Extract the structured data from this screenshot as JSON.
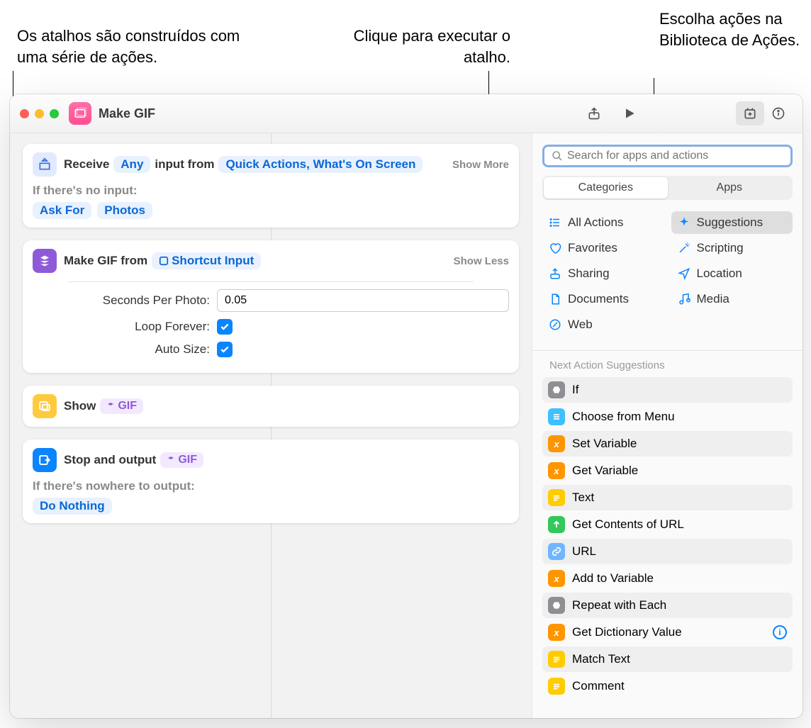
{
  "callouts": {
    "left": "Os atalhos são construídos com uma série de ações.",
    "center": "Clique para executar o atalho.",
    "right": "Escolha ações na Biblioteca de Ações."
  },
  "window": {
    "title": "Make GIF"
  },
  "toolbar": {
    "share_label": "Share",
    "run_label": "Run",
    "library_label": "Action Library",
    "info_label": "Info"
  },
  "editor": {
    "receive": {
      "prefix": "Receive",
      "any": "Any",
      "middle": "input from",
      "from": "Quick Actions, What's On Screen",
      "show_more": "Show More",
      "no_input_label": "If there's no input:",
      "no_input_1": "Ask For",
      "no_input_2": "Photos"
    },
    "makegif": {
      "prefix": "Make GIF from",
      "input_chip": "Shortcut Input",
      "show_less": "Show Less",
      "seconds_label": "Seconds Per Photo:",
      "seconds_value": "0.05",
      "loop_label": "Loop Forever:",
      "auto_label": "Auto Size:"
    },
    "show": {
      "prefix": "Show",
      "chip": "GIF"
    },
    "output": {
      "prefix": "Stop and output",
      "chip": "GIF",
      "nowhere_label": "If there's nowhere to output:",
      "nowhere_chip": "Do Nothing"
    }
  },
  "sidebar": {
    "search_placeholder": "Search for apps and actions",
    "seg": {
      "categories": "Categories",
      "apps": "Apps"
    },
    "cats": [
      {
        "label": "All Actions",
        "icon": "list"
      },
      {
        "label": "Suggestions",
        "icon": "sparkle",
        "selected": true
      },
      {
        "label": "Favorites",
        "icon": "heart"
      },
      {
        "label": "Scripting",
        "icon": "wand"
      },
      {
        "label": "Sharing",
        "icon": "share"
      },
      {
        "label": "Location",
        "icon": "nav"
      },
      {
        "label": "Documents",
        "icon": "doc"
      },
      {
        "label": "Media",
        "icon": "music"
      },
      {
        "label": "Web",
        "icon": "safari"
      }
    ],
    "sugg_title": "Next Action Suggestions",
    "suggestions": [
      {
        "label": "If",
        "color": "gray"
      },
      {
        "label": "Choose from Menu",
        "color": "cyan"
      },
      {
        "label": "Set Variable",
        "color": "orange"
      },
      {
        "label": "Get Variable",
        "color": "orange"
      },
      {
        "label": "Text",
        "color": "yellow"
      },
      {
        "label": "Get Contents of URL",
        "color": "green"
      },
      {
        "label": "URL",
        "color": "lblue"
      },
      {
        "label": "Add to Variable",
        "color": "orange"
      },
      {
        "label": "Repeat with Each",
        "color": "gray"
      },
      {
        "label": "Get Dictionary Value",
        "color": "orange",
        "info": true
      },
      {
        "label": "Match Text",
        "color": "yellow"
      },
      {
        "label": "Comment",
        "color": "yellow"
      }
    ]
  }
}
